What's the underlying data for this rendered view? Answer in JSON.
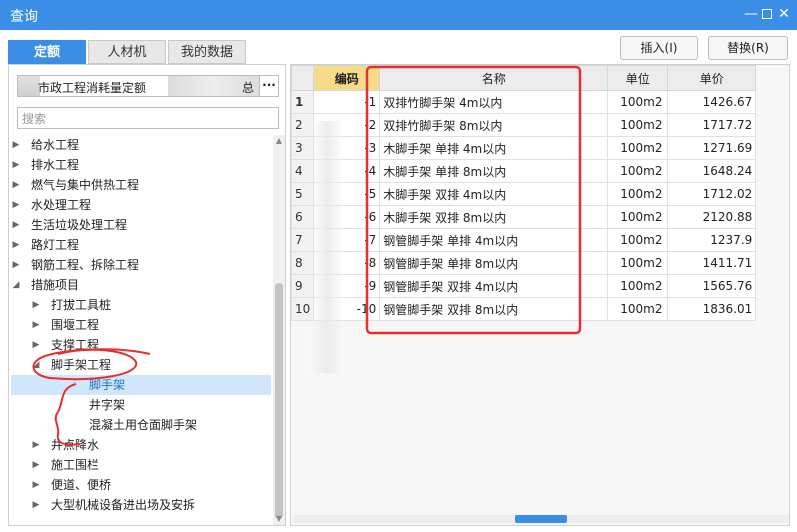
{
  "window": {
    "title": "查询"
  },
  "tabs": [
    {
      "label": "定额",
      "active": true
    },
    {
      "label": "人材机",
      "active": false
    },
    {
      "label": "我的数据",
      "active": false
    }
  ],
  "toolbar": {
    "insert_label": "插入(I)",
    "replace_label": "替换(R)"
  },
  "library": {
    "name_text": "市政工程消耗量定额",
    "name_tail": "总表",
    "more_label": "···"
  },
  "search": {
    "placeholder": "搜索"
  },
  "tree": [
    {
      "label": "给水工程",
      "level": 0,
      "expanded": false
    },
    {
      "label": "排水工程",
      "level": 0,
      "expanded": false
    },
    {
      "label": "燃气与集中供热工程",
      "level": 0,
      "expanded": false
    },
    {
      "label": "水处理工程",
      "level": 0,
      "expanded": false
    },
    {
      "label": "生活垃圾处理工程",
      "level": 0,
      "expanded": false
    },
    {
      "label": "路灯工程",
      "level": 0,
      "expanded": false
    },
    {
      "label": "钢筋工程、拆除工程",
      "level": 0,
      "expanded": false
    },
    {
      "label": "措施项目",
      "level": 0,
      "expanded": true
    },
    {
      "label": "打拔工具桩",
      "level": 1,
      "expanded": false
    },
    {
      "label": "围堰工程",
      "level": 1,
      "expanded": false
    },
    {
      "label": "支撑工程",
      "level": 1,
      "expanded": false
    },
    {
      "label": "脚手架工程",
      "level": 1,
      "expanded": true
    },
    {
      "label": "脚手架",
      "level": 2,
      "selected": true
    },
    {
      "label": "井字架",
      "level": 2
    },
    {
      "label": "混凝土用仓面脚手架",
      "level": 2
    },
    {
      "label": "井点降水",
      "level": 1,
      "expanded": false
    },
    {
      "label": "施工围栏",
      "level": 1,
      "expanded": false
    },
    {
      "label": "便道、便桥",
      "level": 1,
      "expanded": false
    },
    {
      "label": "大型机械设备进出场及安拆",
      "level": 1,
      "expanded": false
    }
  ],
  "table": {
    "headers": {
      "code": "编码",
      "name": "名称",
      "unit": "单位",
      "price": "单价"
    },
    "rows": [
      {
        "rn": "1",
        "code": "-1",
        "name": "双排竹脚手架 4m以内",
        "unit": "100m2",
        "price": "1426.67"
      },
      {
        "rn": "2",
        "code": "-2",
        "name": "双排竹脚手架 8m以内",
        "unit": "100m2",
        "price": "1717.72"
      },
      {
        "rn": "3",
        "code": "-3",
        "name": "木脚手架 单排 4m以内",
        "unit": "100m2",
        "price": "1271.69"
      },
      {
        "rn": "4",
        "code": "-4",
        "name": "木脚手架 单排 8m以内",
        "unit": "100m2",
        "price": "1648.24"
      },
      {
        "rn": "5",
        "code": "-5",
        "name": "木脚手架 双排 4m以内",
        "unit": "100m2",
        "price": "1712.02"
      },
      {
        "rn": "6",
        "code": "-6",
        "name": "木脚手架 双排 8m以内",
        "unit": "100m2",
        "price": "2120.88"
      },
      {
        "rn": "7",
        "code": "-7",
        "name": "钢管脚手架 单排 4m以内",
        "unit": "100m2",
        "price": "1237.9"
      },
      {
        "rn": "8",
        "code": "-8",
        "name": "钢管脚手架 单排 8m以内",
        "unit": "100m2",
        "price": "1411.71"
      },
      {
        "rn": "9",
        "code": "-9",
        "name": "钢管脚手架 双排 4m以内",
        "unit": "100m2",
        "price": "1565.76"
      },
      {
        "rn": "10",
        "code": "-10",
        "name": "钢管脚手架 双排 8m以内",
        "unit": "100m2",
        "price": "1836.01"
      }
    ]
  },
  "colors": {
    "accent": "#3a8ee6",
    "code_header": "#f6dc8a",
    "annotation": "#e53030"
  }
}
